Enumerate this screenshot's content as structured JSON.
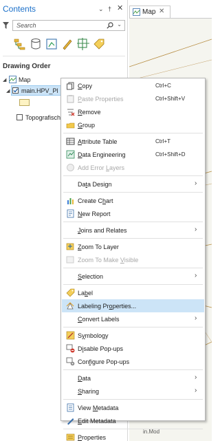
{
  "contents_pane": {
    "title": "Contents",
    "search_placeholder": "Search",
    "drawing_order": "Drawing Order",
    "layers": {
      "map": "Map",
      "main_layer": "main.HPV_Pl",
      "topo_layer": "Topografisch"
    }
  },
  "map_view": {
    "tab_label": "Map",
    "bottom_fragment": "in.Mod"
  },
  "context_menu": {
    "items": [
      {
        "pre": "",
        "u": "C",
        "post": "opy",
        "shortcut": "Ctrl+C",
        "icon": "copy-icon",
        "disabled": false
      },
      {
        "pre": "",
        "u": "P",
        "post": "aste Properties",
        "shortcut": "Ctrl+Shift+V",
        "icon": "paste-properties-icon",
        "disabled": true
      },
      {
        "pre": "",
        "u": "R",
        "post": "emove",
        "shortcut": "",
        "icon": "remove-icon",
        "disabled": false
      },
      {
        "pre": "",
        "u": "G",
        "post": "roup",
        "shortcut": "",
        "icon": "group-icon",
        "disabled": false
      },
      {
        "pre": "",
        "u": "A",
        "post": "ttribute Table",
        "shortcut": "Ctrl+T",
        "icon": "attribute-table-icon",
        "disabled": false
      },
      {
        "pre": "",
        "u": "D",
        "post": "ata Engineering",
        "shortcut": "Ctrl+Shift+D",
        "icon": "data-engineering-icon",
        "disabled": false
      },
      {
        "pre": "Add Error ",
        "u": "L",
        "post": "ayers",
        "shortcut": "",
        "icon": "add-error-layers-icon",
        "disabled": true
      },
      {
        "pre": "Da",
        "u": "t",
        "post": "a Design",
        "shortcut": "",
        "icon": "",
        "disabled": false
      },
      {
        "pre": "Create C",
        "u": "h",
        "post": "art",
        "shortcut": "",
        "icon": "create-chart-icon",
        "disabled": false
      },
      {
        "pre": "",
        "u": "N",
        "post": "ew Report",
        "shortcut": "",
        "icon": "new-report-icon",
        "disabled": false
      },
      {
        "pre": "",
        "u": "J",
        "post": "oins and Relates",
        "shortcut": "",
        "icon": "",
        "disabled": false
      },
      {
        "pre": "",
        "u": "Z",
        "post": "oom To Layer",
        "shortcut": "",
        "icon": "zoom-to-layer-icon",
        "disabled": false
      },
      {
        "pre": "Zoom To Make ",
        "u": "V",
        "post": "isible",
        "shortcut": "",
        "icon": "zoom-to-make-visible-icon",
        "disabled": true
      },
      {
        "pre": "",
        "u": "S",
        "post": "election",
        "shortcut": "",
        "icon": "",
        "disabled": false
      },
      {
        "pre": "La",
        "u": "b",
        "post": "el",
        "shortcut": "",
        "icon": "label-icon",
        "disabled": false
      },
      {
        "pre": "Labeling Pr",
        "u": "o",
        "post": "perties...",
        "shortcut": "",
        "icon": "labeling-properties-icon",
        "disabled": false
      },
      {
        "pre": "",
        "u": "C",
        "post": "onvert Labels",
        "shortcut": "",
        "icon": "",
        "disabled": false
      },
      {
        "pre": "S",
        "u": "y",
        "post": "mbology",
        "shortcut": "",
        "icon": "symbology-icon",
        "disabled": false
      },
      {
        "pre": "D",
        "u": "i",
        "post": "sable Pop-ups",
        "shortcut": "",
        "icon": "disable-popups-icon",
        "disabled": false
      },
      {
        "pre": "Con",
        "u": "f",
        "post": "igure Pop-ups",
        "shortcut": "",
        "icon": "configure-popups-icon",
        "disabled": false
      },
      {
        "pre": "",
        "u": "D",
        "post": "ata",
        "shortcut": "",
        "icon": "",
        "disabled": false
      },
      {
        "pre": "",
        "u": "S",
        "post": "haring",
        "shortcut": "",
        "icon": "",
        "disabled": false
      },
      {
        "pre": "View ",
        "u": "M",
        "post": "etadata",
        "shortcut": "",
        "icon": "view-metadata-icon",
        "disabled": false
      },
      {
        "pre": "",
        "u": "E",
        "post": "dit Metadata",
        "shortcut": "",
        "icon": "edit-metadata-icon",
        "disabled": false
      },
      {
        "pre": "",
        "u": "P",
        "post": "roperties",
        "shortcut": "",
        "icon": "properties-icon",
        "disabled": false
      }
    ],
    "highlighted_item": "Labeling Properties...",
    "colors": {
      "highlight": "#cce4f7",
      "disabled_text": "#a8a8a8",
      "accent": "#1a6fc9"
    }
  }
}
